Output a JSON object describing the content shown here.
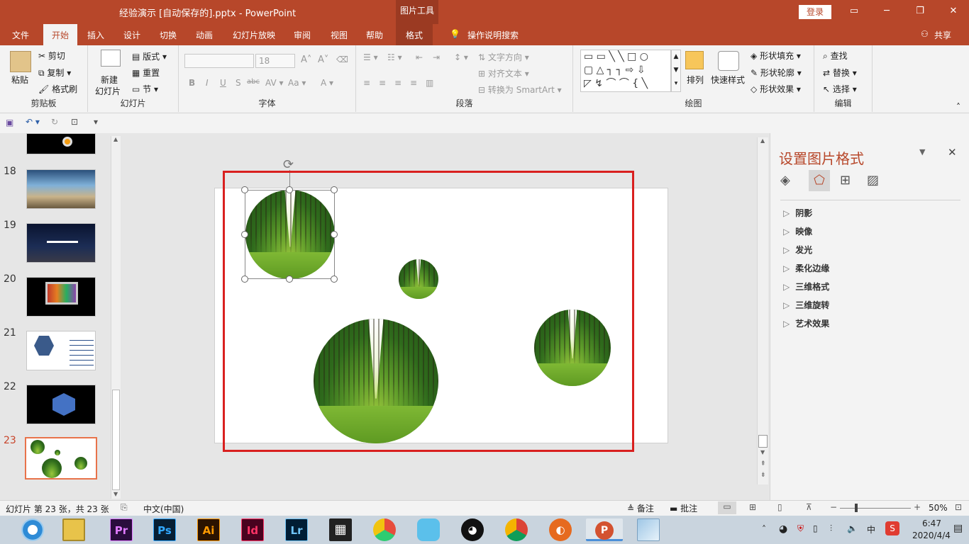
{
  "window": {
    "title": "经验演示 [自动保存的].pptx - PowerPoint",
    "context_tab_group": "图片工具",
    "login": "登录"
  },
  "tabs": [
    "文件",
    "开始",
    "插入",
    "设计",
    "切换",
    "动画",
    "幻灯片放映",
    "审阅",
    "视图",
    "帮助",
    "格式"
  ],
  "tell_me": "操作说明搜索",
  "share": "共享",
  "ribbon": {
    "clipboard": {
      "paste": "粘贴",
      "cut": "剪切",
      "copy": "复制",
      "format_painter": "格式刷",
      "label": "剪贴板"
    },
    "slides": {
      "new_slide_line1": "新建",
      "new_slide_line2": "幻灯片",
      "layout": "版式",
      "reset": "重置",
      "section": "节",
      "label": "幻灯片"
    },
    "font": {
      "size": "18",
      "bold": "B",
      "italic": "I",
      "underline": "U",
      "strike": "S",
      "shadow": "abc",
      "label": "字体"
    },
    "paragraph": {
      "text_direction": "文字方向",
      "align_text": "对齐文本",
      "smartart": "转换为 SmartArt",
      "label": "段落"
    },
    "drawing": {
      "arrange": "排列",
      "quick_styles": "快速样式",
      "fill": "形状填充",
      "outline": "形状轮廓",
      "effects": "形状效果",
      "label": "绘图"
    },
    "editing": {
      "find": "查找",
      "replace": "替换",
      "select": "选择",
      "label": "编辑"
    }
  },
  "thumbnails": [
    {
      "num": "18"
    },
    {
      "num": "19"
    },
    {
      "num": "20"
    },
    {
      "num": "21"
    },
    {
      "num": "22"
    },
    {
      "num": "23"
    }
  ],
  "task_pane": {
    "title": "设置图片格式",
    "items": [
      "阴影",
      "映像",
      "发光",
      "柔化边缘",
      "三维格式",
      "三维旋转",
      "艺术效果"
    ]
  },
  "status_bar": {
    "slide_info": "幻灯片 第 23 张，共 23 张",
    "language": "中文(中国)",
    "notes": "备注",
    "comments": "批注",
    "zoom": "50%"
  },
  "taskbar": {
    "apps": [
      "Pr",
      "Ps",
      "Ai",
      "Id",
      "Lr"
    ],
    "ime": "中",
    "time": "6:47",
    "date": "2020/4/4"
  },
  "colors": {
    "accent": "#b7472a",
    "highlight": "#d9201f",
    "selected_thumb": "#e8734a"
  }
}
